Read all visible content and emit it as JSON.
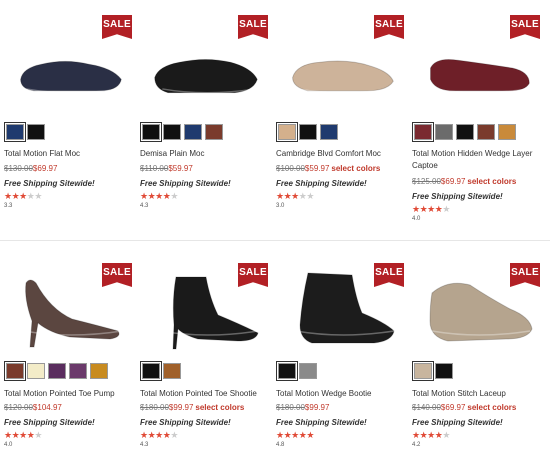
{
  "sale_label": "SALE",
  "shipping_text": "Free Shipping Sitewide!",
  "select_colors_text": "select colors",
  "products": [
    {
      "name": "Total Motion Flat Moc",
      "old_price": "$130.00",
      "new_price": "$69.97",
      "select_colors": false,
      "rating": "3.3",
      "stars": 3.3,
      "swatches": [
        "#1f3a6e",
        "#111111"
      ],
      "shoe_color": "#2a2f45"
    },
    {
      "name": "Demisa Plain Moc",
      "old_price": "$110.00",
      "new_price": "$59.97",
      "select_colors": false,
      "rating": "4.3",
      "stars": 4.3,
      "swatches": [
        "#0f0f0f",
        "#111111",
        "#1f3a6e",
        "#7a3b2c"
      ],
      "shoe_color": "#1a1a1a"
    },
    {
      "name": "Cambridge Blvd Comfort Moc",
      "old_price": "$100.00",
      "new_price": "$59.97",
      "select_colors": true,
      "rating": "3.0",
      "stars": 3.0,
      "swatches": [
        "#d4b08c",
        "#111111",
        "#1f3a6e"
      ],
      "shoe_color": "#cdb39a"
    },
    {
      "name": "Total Motion Hidden Wedge Layer Captoe",
      "old_price": "$125.00",
      "new_price": "$69.97",
      "select_colors": true,
      "rating": "4.0",
      "stars": 4.0,
      "swatches": [
        "#7a2a30",
        "#6b6b6b",
        "#111111",
        "#7a3b2c",
        "#c98a3a"
      ],
      "shoe_color": "#6e1f28"
    },
    {
      "name": "Total Motion Pointed Toe Pump",
      "old_price": "$120.00",
      "new_price": "$104.97",
      "select_colors": false,
      "rating": "4.0",
      "stars": 4.0,
      "swatches": [
        "#7a3b2c",
        "#f3ecc8",
        "#5a2d5e",
        "#6b3a6b",
        "#c88b1f"
      ],
      "shoe_color": "#5b4640"
    },
    {
      "name": "Total Motion Pointed Toe Shootie",
      "old_price": "$180.00",
      "new_price": "$99.97",
      "select_colors": true,
      "rating": "4.3",
      "stars": 4.3,
      "swatches": [
        "#111111",
        "#a0602a"
      ],
      "shoe_color": "#1a1a1a"
    },
    {
      "name": "Total Motion Wedge Bootie",
      "old_price": "$180.00",
      "new_price": "$99.97",
      "select_colors": false,
      "rating": "4.8",
      "stars": 4.8,
      "swatches": [
        "#111111",
        "#8a8a8a"
      ],
      "shoe_color": "#1c1c1c"
    },
    {
      "name": "Total Motion Stitch Laceup",
      "old_price": "$140.00",
      "new_price": "$69.97",
      "select_colors": true,
      "rating": "4.2",
      "stars": 4.2,
      "swatches": [
        "#c8b59e",
        "#111111"
      ],
      "shoe_color": "#b5a48e"
    }
  ],
  "colors": {
    "sale_bg": "#b22025",
    "price_red": "#c0392b",
    "star_on": "#e04a36",
    "star_off": "#cccccc"
  }
}
